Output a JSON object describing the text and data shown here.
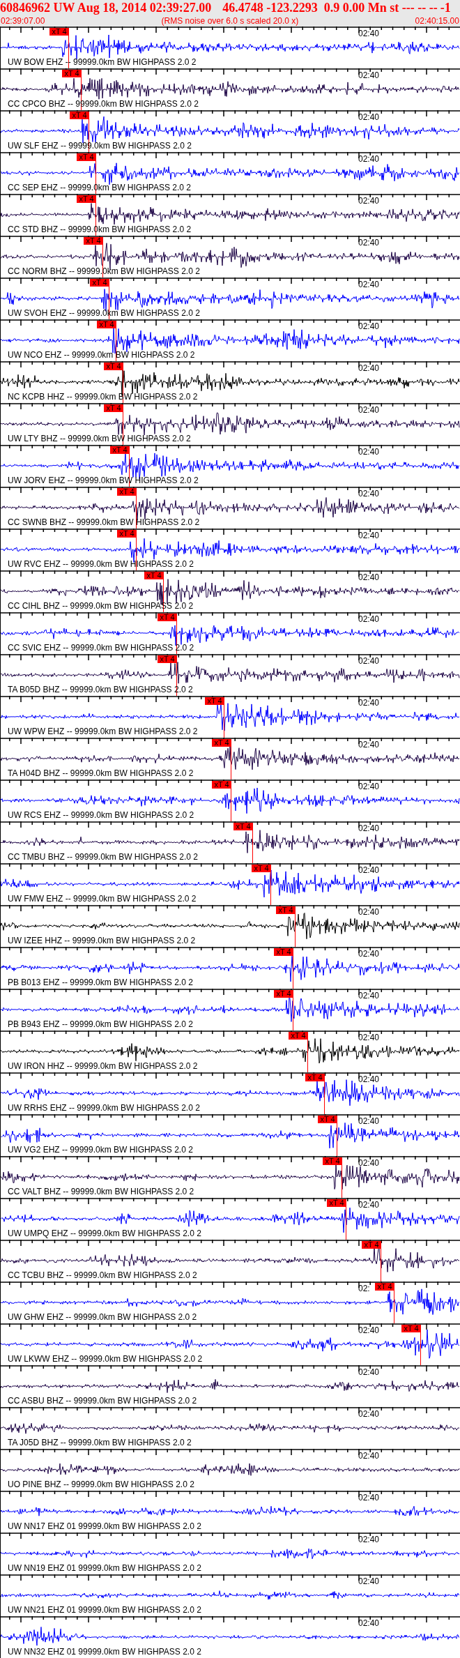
{
  "header": {
    "title_parts": [
      "60846962 UW Aug 18, 2014 02:39:27.00",
      "46.4748 -123.2293",
      "0.9 0.00 Mn st --- -- --",
      "-1"
    ],
    "start_time": "02:39:07.00",
    "note": "(RMS noise over 6.0 s scaled 20.0 x)",
    "end_time": "02:40:15.00"
  },
  "traces": [
    {
      "label": "UW BOW EHZ -- 99999.0km BW HIGHPASS 2.0 2",
      "time_label": "02:40",
      "color": "#0000ff",
      "pick": {
        "label": "xT 4"
      }
    },
    {
      "label": "CC CPCO BHZ -- 99999.0km BW HIGHPASS 2.0 2",
      "time_label": "02:40",
      "color": "#200848",
      "pick": {
        "label": "xT 4"
      }
    },
    {
      "label": "UW SLF EHZ -- 99999.0km BW HIGHPASS 2.0 2",
      "time_label": "02:40",
      "color": "#0000ff",
      "pick": {
        "label": "xT 4"
      }
    },
    {
      "label": "CC SEP EHZ -- 99999.0km BW HIGHPASS 2.0 2",
      "time_label": "02:40",
      "color": "#0000ff",
      "pick": {
        "label": "xT 4"
      }
    },
    {
      "label": "CC STD BHZ -- 99999.0km BW HIGHPASS 2.0 2",
      "time_label": "02:40",
      "color": "#200848",
      "pick": {
        "label": "xT 4"
      }
    },
    {
      "label": "CC NORM BHZ -- 99999.0km BW HIGHPASS 2.0 2",
      "time_label": "02:40",
      "color": "#200848",
      "pick": {
        "label": "xT 4"
      }
    },
    {
      "label": "UW SVOH EHZ -- 99999.0km BW HIGHPASS 2.0 2",
      "time_label": "02:40",
      "color": "#0000ff",
      "pick": {
        "label": "xT 4"
      }
    },
    {
      "label": "UW NCO EHZ -- 99999.0km BW HIGHPASS 2.0 2",
      "time_label": "02:40",
      "color": "#0000ff",
      "pick": {
        "label": "xT 4"
      }
    },
    {
      "label": "NC KCPB HHZ -- 99999.0km BW HIGHPASS 2.0 2",
      "time_label": "02:40",
      "color": "#000000",
      "pick": {
        "label": "xT 4"
      }
    },
    {
      "label": "UW LTY BHZ -- 99999.0km BW HIGHPASS 2.0 2",
      "time_label": "02:40",
      "color": "#200848",
      "pick": {
        "label": "xT 4"
      }
    },
    {
      "label": "UW JORV EHZ -- 99999.0km BW HIGHPASS 2.0 2",
      "time_label": "02:40",
      "color": "#0000ff",
      "pick": {
        "label": "xT 4"
      }
    },
    {
      "label": "CC SWNB BHZ -- 99999.0km BW HIGHPASS 2.0 2",
      "time_label": "02:40",
      "color": "#200848",
      "pick": {
        "label": "xT 4"
      }
    },
    {
      "label": "UW RVC EHZ -- 99999.0km BW HIGHPASS 2.0 2",
      "time_label": "02:40",
      "color": "#0000ff",
      "pick": {
        "label": "xT 4"
      }
    },
    {
      "label": "CC CIHL BHZ -- 99999.0km BW HIGHPASS 2.0 2",
      "time_label": "02:40",
      "color": "#200848",
      "pick": {
        "label": "xT 4"
      }
    },
    {
      "label": "CC SVIC EHZ -- 99999.0km BW HIGHPASS 2.0 2",
      "time_label": "02:40",
      "color": "#0000ff",
      "pick": {
        "label": "xT 4"
      }
    },
    {
      "label": "TA B05D BHZ -- 99999.0km BW HIGHPASS 2.0 2",
      "time_label": "02:40",
      "color": "#200848",
      "pick": {
        "label": "xT 4"
      }
    },
    {
      "label": "UW WPW EHZ -- 99999.0km BW HIGHPASS 2.0 2",
      "time_label": "02:40",
      "color": "#0000ff",
      "pick": {
        "label": "xT 4"
      }
    },
    {
      "label": "TA H04D BHZ -- 99999.0km BW HIGHPASS 2.0 2",
      "time_label": "02:40",
      "color": "#200848",
      "pick": {
        "label": "xT 4"
      }
    },
    {
      "label": "UW RCS EHZ -- 99999.0km BW HIGHPASS 2.0 2",
      "time_label": "02:40",
      "color": "#0000ff",
      "pick": {
        "label": "xT 4"
      }
    },
    {
      "label": "CC TMBU BHZ -- 99999.0km BW HIGHPASS 2.0 2",
      "time_label": "02:40",
      "color": "#200848",
      "pick": {
        "label": "xT 4"
      }
    },
    {
      "label": "UW FMW EHZ -- 99999.0km BW HIGHPASS 2.0 2",
      "time_label": "02:40",
      "color": "#0000ff",
      "pick": {
        "label": "xT 4"
      }
    },
    {
      "label": "UW IZEE HHZ -- 99999.0km BW HIGHPASS 2.0 2",
      "time_label": "02:40",
      "color": "#000000",
      "pick": {
        "label": "xT 4"
      }
    },
    {
      "label": "PB B013 EHZ -- 99999.0km BW HIGHPASS 2.0 2",
      "time_label": "02:40",
      "color": "#0000ff",
      "pick": {
        "label": "xT 4"
      }
    },
    {
      "label": "PB B943 EHZ -- 99999.0km BW HIGHPASS 2.0 2",
      "time_label": "02:40",
      "color": "#0000ff",
      "pick": {
        "label": "xT 4"
      }
    },
    {
      "label": "UW IRON HHZ -- 99999.0km BW HIGHPASS 2.0 2",
      "time_label": "02:40",
      "color": "#000000",
      "pick": {
        "label": "xT 4"
      }
    },
    {
      "label": "UW RRHS EHZ -- 99999.0km BW HIGHPASS 2.0 2",
      "time_label": "02:40",
      "color": "#0000ff",
      "pick": {
        "label": "xT 4"
      }
    },
    {
      "label": "UW VG2 EHZ -- 99999.0km BW HIGHPASS 2.0 2",
      "time_label": "02:40",
      "color": "#0000ff",
      "pick": {
        "label": "xT 4"
      }
    },
    {
      "label": "CC VALT BHZ -- 99999.0km BW HIGHPASS 2.0 2",
      "time_label": "02:40",
      "color": "#200848",
      "pick": {
        "label": "xT 4"
      }
    },
    {
      "label": "UW UMPQ EHZ -- 99999.0km BW HIGHPASS 2.0 2",
      "time_label": "02:40",
      "color": "#0000ff",
      "pick": {
        "label": "xT 4"
      }
    },
    {
      "label": "CC TCBU BHZ -- 99999.0km BW HIGHPASS 2.0 2",
      "color": "#200848",
      "pick": {
        "label": "xT 4"
      }
    },
    {
      "label": "UW GHW EHZ -- 99999.0km BW HIGHPASS 2.0 2",
      "time_label": "02:",
      "color": "#0000ff",
      "pick": {
        "label": "xT 4"
      }
    },
    {
      "label": "UW LKWW EHZ -- 99999.0km BW HIGHPASS 2.0 2",
      "time_label": "02:40",
      "color": "#0000ff",
      "pick": {
        "label": "xT 4"
      }
    },
    {
      "label": "CC ASBU BHZ -- 99999.0km BW HIGHPASS 2.0 2",
      "time_label": "02:40",
      "color": "#200848"
    },
    {
      "label": "TA J05D BHZ -- 99999.0km BW HIGHPASS 2.0 2",
      "time_label": "02:40",
      "color": "#200848"
    },
    {
      "label": "UO PINE BHZ -- 99999.0km BW HIGHPASS 2.0 2",
      "time_label": "02:40",
      "color": "#200848"
    },
    {
      "label": "UW NN17 EHZ 01 99999.0km BW HIGHPASS 2.0 2",
      "time_label": "02:40",
      "color": "#0000ff"
    },
    {
      "label": "UW NN19 EHZ 01 99999.0km BW HIGHPASS 2.0 2",
      "time_label": "02:40",
      "color": "#0000ff"
    },
    {
      "label": "UW NN21 EHZ 01 99999.0km BW HIGHPASS 2.0 2",
      "time_label": "02:40",
      "color": "#0000ff"
    },
    {
      "label": "UW NN32 EHZ 01 99999.0km BW HIGHPASS 2.0 2",
      "time_label": "02:40",
      "color": "#0000ff"
    }
  ]
}
